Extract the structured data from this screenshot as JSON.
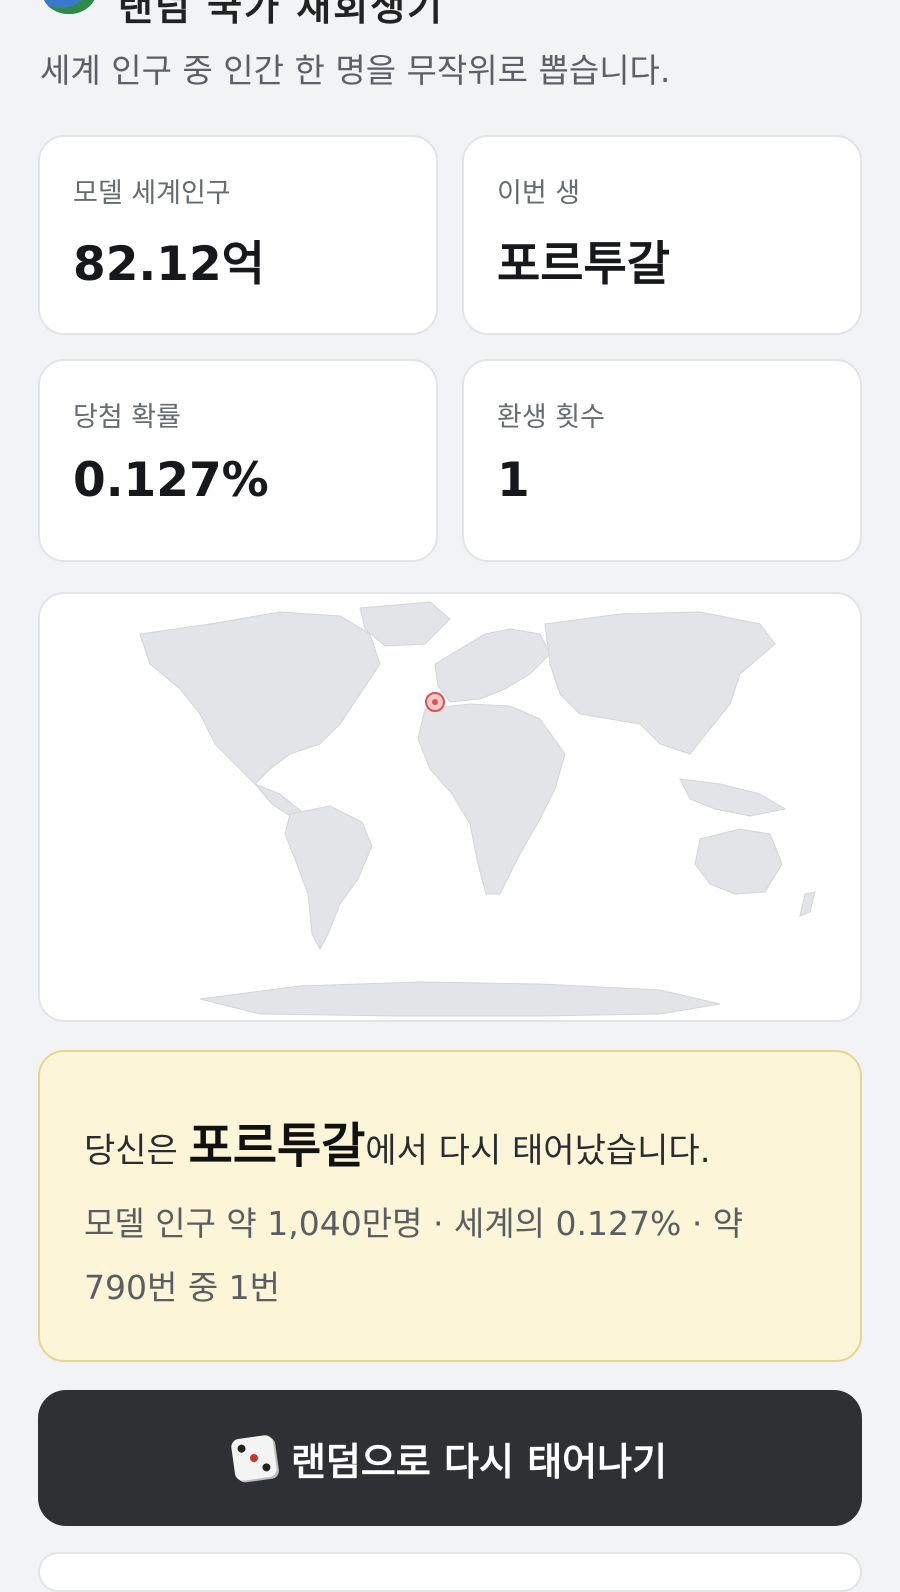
{
  "header": {
    "title": "랜덤 국가 재회생기",
    "subtitle": "세계 인구 중 인간 한 명을 무작위로 뽑습니다."
  },
  "stats": [
    {
      "label": "모델 세계인구",
      "value": "82.12억"
    },
    {
      "label": "이번 생",
      "value": "포르투갈"
    },
    {
      "label": "당첨 확률",
      "value": "0.127%"
    },
    {
      "label": "환생 횟수",
      "value": "1"
    }
  ],
  "map": {
    "marker_country": "Portugal",
    "land_color": "#e3e4e7",
    "marker_color": "#d9534f"
  },
  "result": {
    "prefix": "당신은 ",
    "country": "포르투갈",
    "suffix": "에서 다시 태어났습니다.",
    "detail": "모델 인구 약 1,040만명 · 세계의 0.127% · 약 790번 중 1번"
  },
  "actions": {
    "reroll_label": "랜덤으로 다시 태어나기",
    "reroll_icon": "dice-icon"
  },
  "colors": {
    "accent_dark": "#2f3033",
    "result_bg": "#fdf5d7",
    "result_border": "#e9d58f"
  }
}
